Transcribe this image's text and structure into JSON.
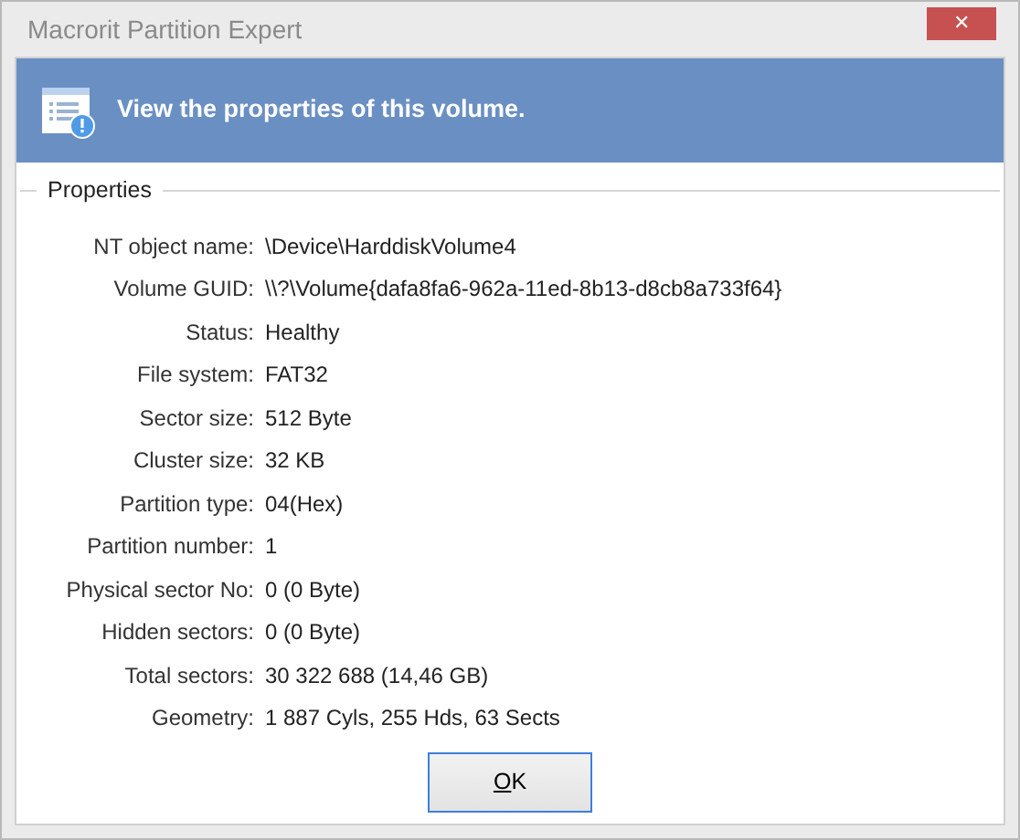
{
  "window": {
    "title": "Macrorit Partition Expert",
    "close": "✕"
  },
  "banner": {
    "text": "View the properties of this volume."
  },
  "group": {
    "title": "Properties"
  },
  "properties": [
    {
      "label": "NT object name:",
      "value": "\\Device\\HarddiskVolume4"
    },
    {
      "label": "Volume GUID:",
      "value": "\\\\?\\Volume{dafa8fa6-962a-11ed-8b13-d8cb8a733f64}"
    },
    {
      "label": "Status:",
      "value": "Healthy"
    },
    {
      "label": "File system:",
      "value": "FAT32"
    },
    {
      "label": "Sector size:",
      "value": "512 Byte"
    },
    {
      "label": "Cluster size:",
      "value": "32 KB"
    },
    {
      "label": "Partition type:",
      "value": "04(Hex)"
    },
    {
      "label": "Partition number:",
      "value": "1"
    },
    {
      "label": "Physical sector No:",
      "value": "0 (0 Byte)"
    },
    {
      "label": "Hidden sectors:",
      "value": "0 (0 Byte)"
    },
    {
      "label": "Total sectors:",
      "value": "30 322 688 (14,46 GB)"
    },
    {
      "label": "Geometry:",
      "value": "1 887 Cyls, 255 Hds, 63 Sects"
    }
  ],
  "buttons": [
    {
      "label": "OK",
      "default": true
    }
  ]
}
